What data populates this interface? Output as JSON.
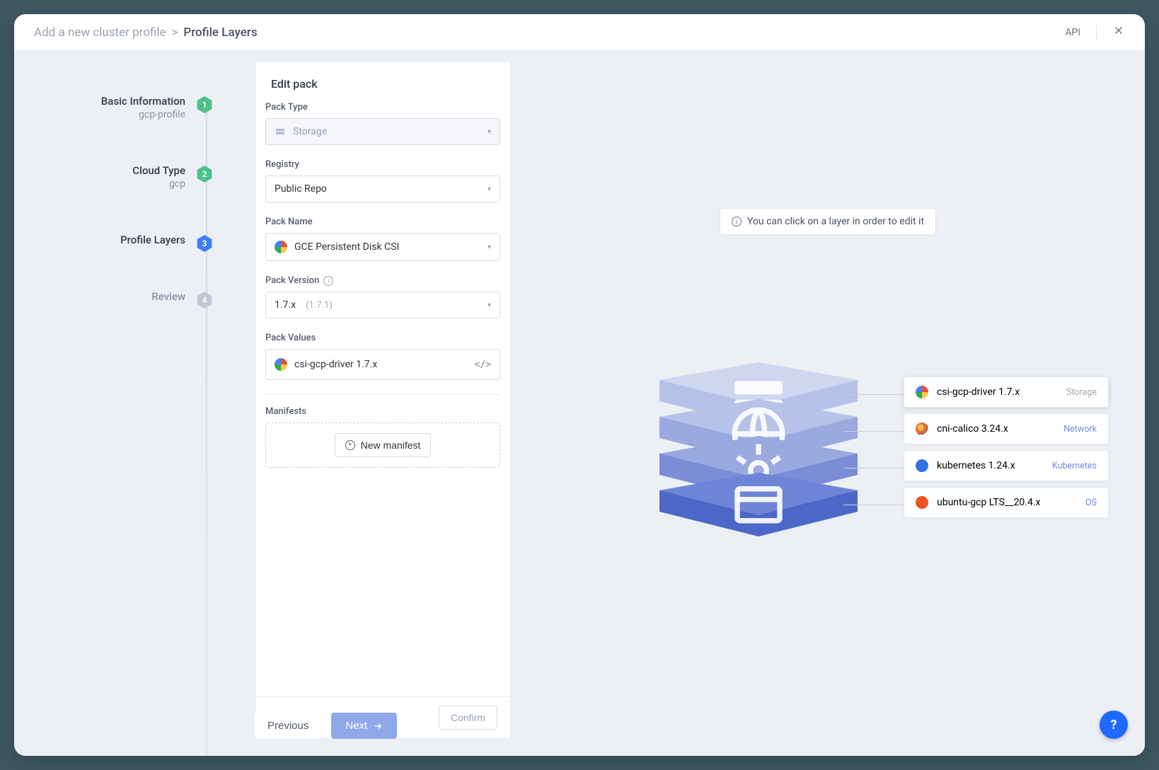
{
  "breadcrumb": {
    "root": "Add a new cluster profile",
    "current": "Profile Layers"
  },
  "header": {
    "api": "API"
  },
  "steps": [
    {
      "title": "Basic Information",
      "sub": "gcp-profile",
      "num": "1",
      "state": "green"
    },
    {
      "title": "Cloud Type",
      "sub": "gcp",
      "num": "2",
      "state": "green"
    },
    {
      "title": "Profile Layers",
      "sub": "",
      "num": "3",
      "state": "blue"
    },
    {
      "title": "Review",
      "sub": "",
      "num": "4",
      "state": "gray"
    }
  ],
  "panel": {
    "title": "Edit pack",
    "packTypeLabel": "Pack Type",
    "packTypeValue": "Storage",
    "registryLabel": "Registry",
    "registryValue": "Public Repo",
    "packNameLabel": "Pack Name",
    "packNameValue": "GCE Persistent Disk CSI",
    "packVersionLabel": "Pack Version",
    "packVersionValue": "1.7.x",
    "packVersionSub": "(1.7.1)",
    "packValuesLabel": "Pack Values",
    "packValuesValue": "csi-gcp-driver 1.7.x",
    "manifestsLabel": "Manifests",
    "newManifest": "New manifest",
    "confirm": "Confirm"
  },
  "hint": "You can click on a layer in order to edit it",
  "layers": [
    {
      "name": "csi-gcp-driver 1.7.x",
      "tag": "Storage",
      "icon": "sprite-g",
      "active": true,
      "tagMuted": true
    },
    {
      "name": "cni-calico 3.24.x",
      "tag": "Network",
      "icon": "sprite-calico",
      "active": false,
      "tagMuted": false
    },
    {
      "name": "kubernetes 1.24.x",
      "tag": "Kubernetes",
      "icon": "sprite-k8s",
      "active": false,
      "tagMuted": false
    },
    {
      "name": "ubuntu-gcp LTS__20.4.x",
      "tag": "OS",
      "icon": "sprite-ubuntu",
      "active": false,
      "tagMuted": false
    }
  ],
  "nav": {
    "prev": "Previous",
    "next": "Next"
  },
  "colors": {
    "plate1": [
      "#cfd6f0",
      "#b6c1e8"
    ],
    "plate2": [
      "#b7c2e8",
      "#9aa9df"
    ],
    "plate3": [
      "#9aa9df",
      "#7b8dd7"
    ],
    "plate4": [
      "#6e84d6",
      "#4d67c8"
    ]
  }
}
